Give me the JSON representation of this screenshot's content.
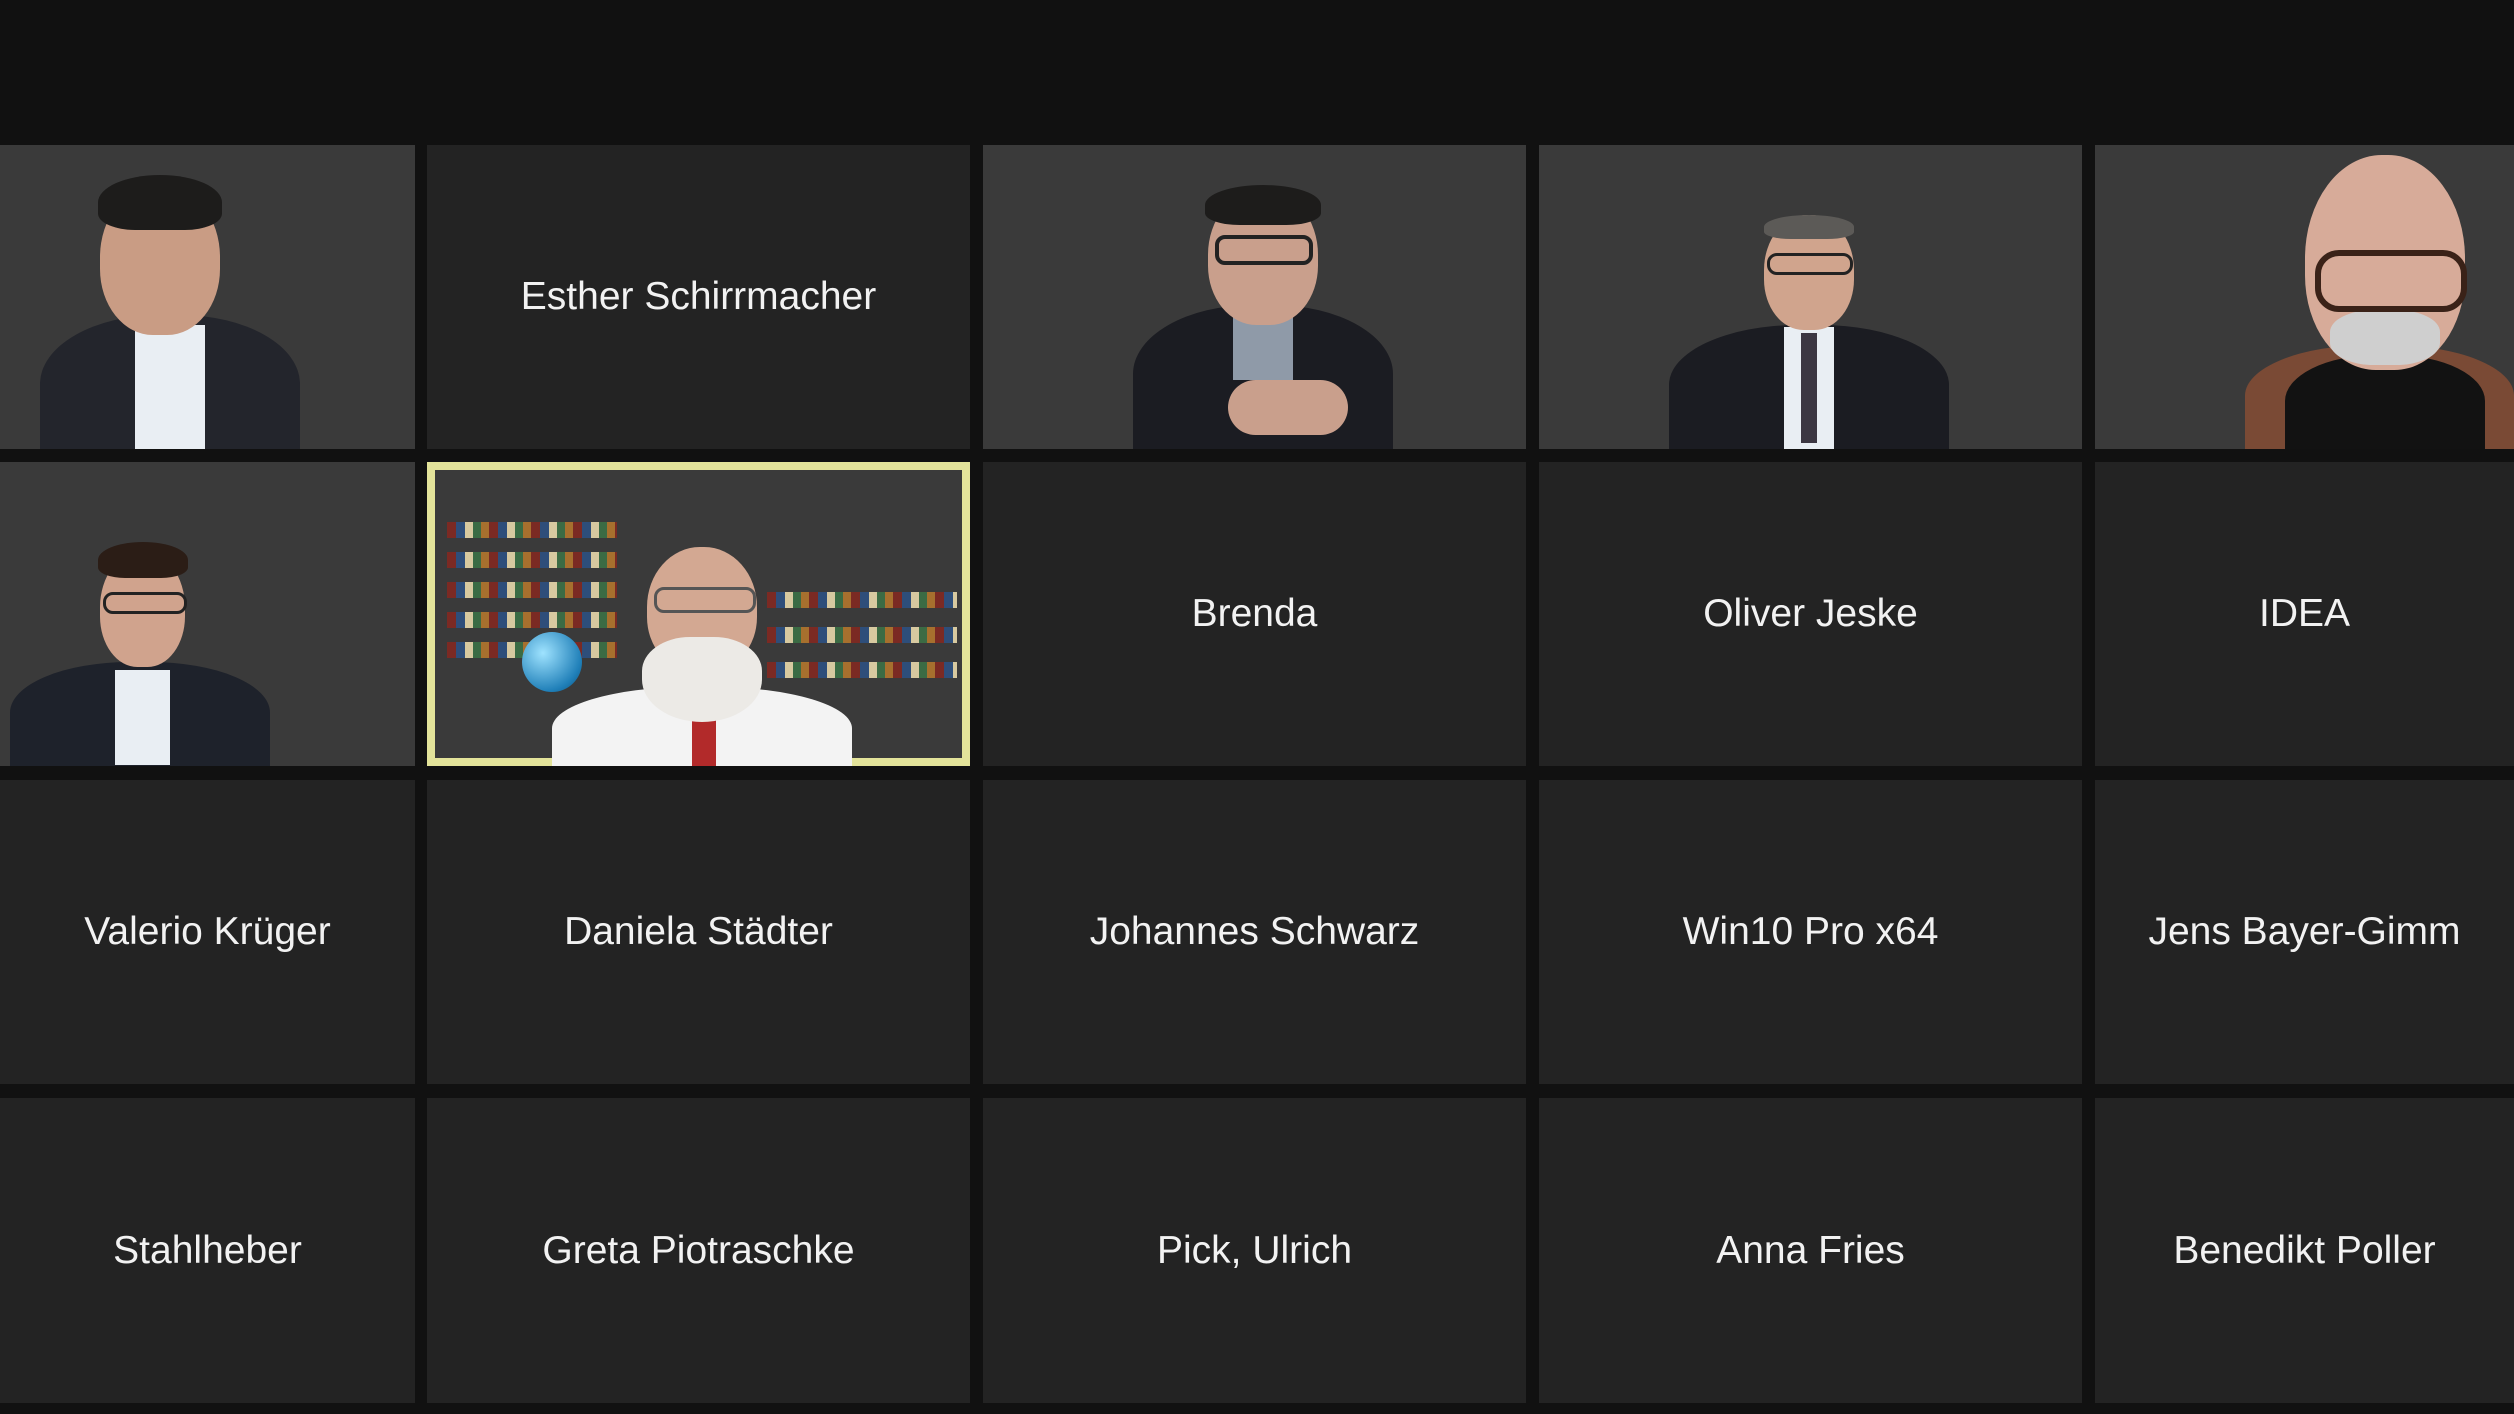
{
  "meeting": {
    "participants": [
      {
        "name": "",
        "video": true
      },
      {
        "name": "Esther Schirrmacher",
        "video": false
      },
      {
        "name": "",
        "video": true
      },
      {
        "name": "",
        "video": true
      },
      {
        "name": "",
        "video": true
      },
      {
        "name": "",
        "video": true
      },
      {
        "name": "",
        "video": true,
        "active_speaker": true
      },
      {
        "name": "Brenda",
        "video": false
      },
      {
        "name": "Oliver Jeske",
        "video": false
      },
      {
        "name": "IDEA",
        "video": false
      },
      {
        "name": "Valerio Krüger",
        "video": false
      },
      {
        "name": "Daniela Städter",
        "video": false
      },
      {
        "name": "Johannes Schwarz",
        "video": false
      },
      {
        "name": "Win10 Pro x64",
        "video": false
      },
      {
        "name": "Jens Bayer-Gimm",
        "video": false
      },
      {
        "name": "Stahlheber",
        "video": false
      },
      {
        "name": "Greta Piotraschke",
        "video": false
      },
      {
        "name": "Pick, Ulrich",
        "video": false
      },
      {
        "name": "Anna Fries",
        "video": false
      },
      {
        "name": "Benedikt Poller",
        "video": false
      }
    ]
  },
  "colors": {
    "background": "#111111",
    "tile": "#232323",
    "active_speaker_border": "#e3e39a",
    "name_text": "#f2f2f2"
  }
}
